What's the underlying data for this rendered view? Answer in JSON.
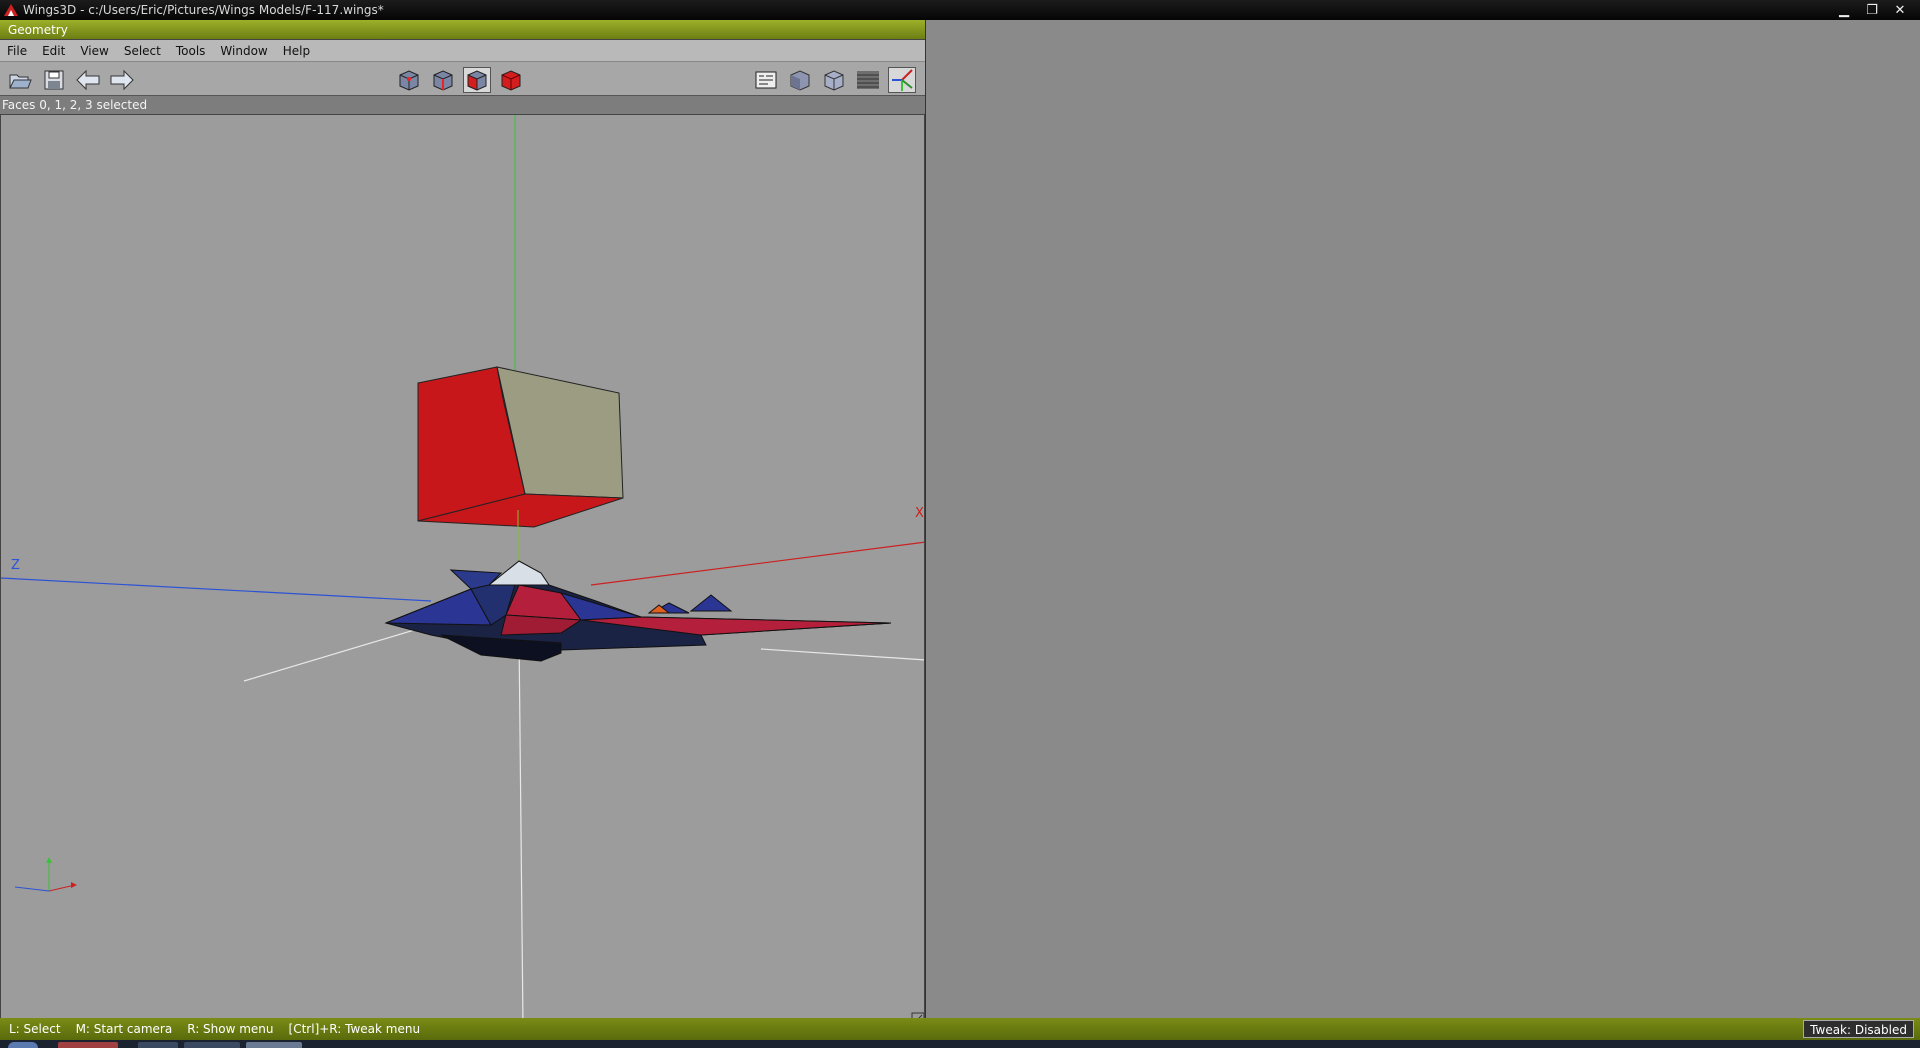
{
  "titlebar": {
    "title": "Wings3D - c:/Users/Eric/Pictures/Wings Models/F-117.wings*",
    "controls": [
      "minimize-icon",
      "restore-icon",
      "close-icon"
    ]
  },
  "geometry_window": {
    "title": "Geometry",
    "menu": [
      "File",
      "Edit",
      "View",
      "Select",
      "Tools",
      "Window",
      "Help"
    ],
    "toolbar": {
      "left_icons": [
        "open-folder-icon",
        "save-icon",
        "undo-arrow-icon",
        "redo-arrow-icon"
      ],
      "selection_modes": [
        "vertex-mode-icon",
        "edge-mode-icon",
        "face-mode-icon",
        "object-mode-icon"
      ],
      "active_selection_mode": "face-mode-icon",
      "view_icons": [
        "groundplane-icon",
        "smooth-shade-icon",
        "flat-cube-icon",
        "grid-icon",
        "axes-icon"
      ]
    },
    "status": "Faces 0, 1, 2, 3 selected",
    "axis_labels": {
      "x": "X",
      "z": "Z"
    },
    "colors": {
      "selection": "#c8171a",
      "axis_x": "#cc2020",
      "axis_y": "#3ac23a",
      "axis_z": "#2c52d6",
      "model_blue": "#2a3594",
      "model_red": "#b4203c"
    }
  },
  "infobar": {
    "hints": [
      "L: Select",
      "M: Start camera",
      "R: Show menu",
      "[Ctrl]+R: Tweak menu"
    ],
    "tweak": "Tweak: Disabled"
  }
}
